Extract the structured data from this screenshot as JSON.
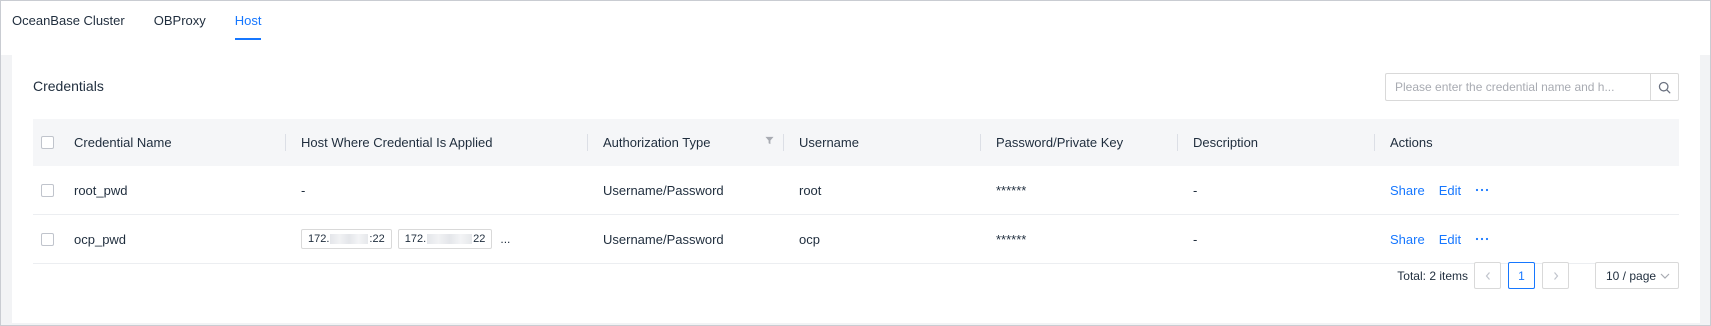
{
  "tabs": [
    {
      "label": "OceanBase Cluster",
      "active": false
    },
    {
      "label": "OBProxy",
      "active": false
    },
    {
      "label": "Host",
      "active": true
    }
  ],
  "card": {
    "title": "Credentials",
    "search_placeholder": "Please enter the credential name and h..."
  },
  "table": {
    "columns": {
      "name": "Credential Name",
      "host": "Host Where Credential Is Applied",
      "auth": "Authorization Type",
      "user": "Username",
      "pwd": "Password/Private Key",
      "desc": "Description",
      "actions": "Actions"
    },
    "rows": [
      {
        "name": "root_pwd",
        "host": "-",
        "auth": "Username/Password",
        "user": "root",
        "pwd": "******",
        "desc": "-",
        "share": "Share",
        "edit": "Edit"
      },
      {
        "name": "ocp_pwd",
        "host_tags": [
          {
            "prefix": "172.",
            "suffix": ":22"
          },
          {
            "prefix": "172.",
            "suffix": "22"
          }
        ],
        "host_more": "...",
        "auth": "Username/Password",
        "user": "ocp",
        "pwd": "******",
        "desc": "-",
        "share": "Share",
        "edit": "Edit"
      }
    ]
  },
  "pagination": {
    "total": "Total: 2 items",
    "current_page": "1",
    "page_size": "10 / page"
  },
  "colors": {
    "accent": "#1677ff",
    "header_bg": "#f5f6f8",
    "page_bg": "#f2f3f5"
  },
  "icons": [
    "search-icon",
    "filter-icon",
    "ellipsis-icon",
    "chevron-left-icon",
    "chevron-right-icon",
    "chevron-down-icon"
  ]
}
